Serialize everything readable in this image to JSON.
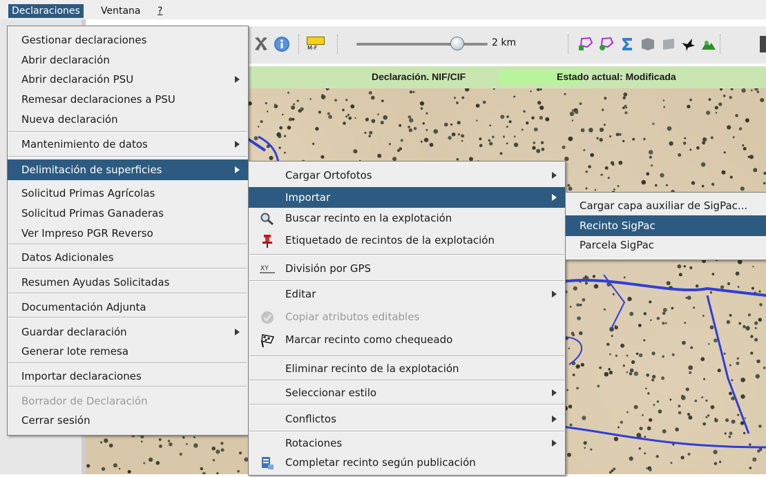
{
  "menubar": {
    "items": [
      "Declaraciones",
      "Ventana",
      "?"
    ]
  },
  "toolbar": {
    "scale_label": "2 km",
    "scale_icon_text": "M-F"
  },
  "statusbar": {
    "label": "Declaración. NIF/CIF",
    "state": "Estado actual: Modificada"
  },
  "menu1": {
    "items": [
      {
        "label": "Gestionar declaraciones"
      },
      {
        "label": "Abrir declaración"
      },
      {
        "label": "Abrir declaración PSU",
        "submenu": true
      },
      {
        "label": "Remesar declaraciones a PSU"
      },
      {
        "label": "Nueva declaración"
      },
      {
        "label": "Mantenimiento de datos",
        "submenu": true
      },
      {
        "label": "Delimitación de superficies",
        "submenu": true,
        "selected": true
      },
      {
        "label": "Solicitud Primas Agrícolas"
      },
      {
        "label": "Solicitud Primas Ganaderas"
      },
      {
        "label": "Ver Impreso PGR Reverso"
      },
      {
        "label": "Datos Adicionales"
      },
      {
        "label": "Resumen Ayudas Solicitadas"
      },
      {
        "label": "Documentación Adjunta"
      },
      {
        "label": "Guardar declaración",
        "submenu": true
      },
      {
        "label": "Generar lote remesa"
      },
      {
        "label": "Importar declaraciones"
      },
      {
        "label": "Borrador de Declaración",
        "disabled": true
      },
      {
        "label": "Cerrar sesión"
      }
    ]
  },
  "menu2": {
    "items": [
      {
        "label": "Cargar Ortofotos",
        "submenu": true
      },
      {
        "label": "Importar",
        "submenu": true,
        "selected": true
      },
      {
        "label": "Buscar recinto en la explotación",
        "icon": "magnifier-icon"
      },
      {
        "label": "Etiquetado de recintos de la explotación",
        "icon": "pushpin-icon"
      },
      {
        "label": "División por GPS",
        "icon": "xy-gps-icon"
      },
      {
        "label": "Editar",
        "submenu": true
      },
      {
        "label": "Copiar atributos editables",
        "icon": "copy-attributes-icon",
        "disabled": true
      },
      {
        "label": "Marcar recinto como chequeado",
        "icon": "checkered-flag-icon"
      },
      {
        "label": "Eliminar recinto de la explotación"
      },
      {
        "label": "Seleccionar estilo",
        "submenu": true
      },
      {
        "label": "Conflictos",
        "submenu": true
      },
      {
        "label": "Rotaciones",
        "submenu": true
      },
      {
        "label": "Completar recinto según publicación",
        "icon": "document-edit-icon"
      }
    ]
  },
  "menu3": {
    "items": [
      {
        "label": "Cargar capa auxiliar de SigPac..."
      },
      {
        "label": "Recinto SigPac",
        "selected": true
      },
      {
        "label": "Parcela SigPac"
      }
    ]
  },
  "colors": {
    "menu_selection": "#2c5a80",
    "statusbar_bg": "#c9e6b2",
    "menu_bg": "#eeeeee",
    "map_boundary": "#2f3fd6"
  }
}
